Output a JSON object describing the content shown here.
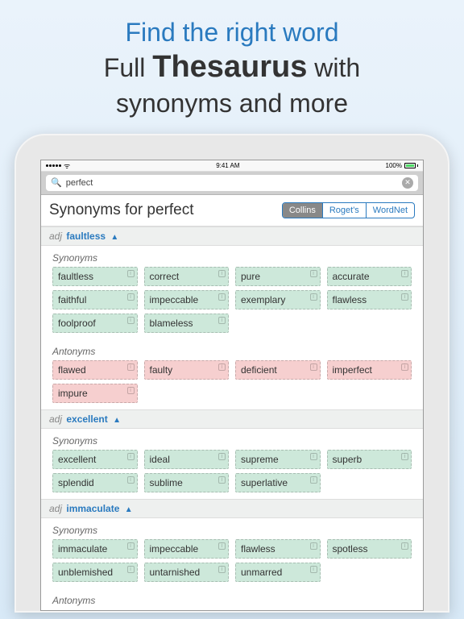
{
  "promo": {
    "line1": "Find the right word",
    "line2_a": "Full ",
    "line2_b": "Thesaurus",
    "line2_c": " with",
    "line3": "synonyms and more"
  },
  "statusbar": {
    "time": "9:41 AM",
    "battery": "100%"
  },
  "search": {
    "value": "perfect"
  },
  "header": {
    "title": "Synonyms for perfect"
  },
  "sources": {
    "collins": "Collins",
    "rogets": "Roget's",
    "wordnet": "WordNet"
  },
  "labels": {
    "synonyms": "Synonyms",
    "antonyms": "Antonyms",
    "pos_adj": "adj",
    "triangle": "▲"
  },
  "senses": {
    "s1": {
      "term": "faultless",
      "syn": [
        "faultless",
        "correct",
        "pure",
        "accurate",
        "faithful",
        "impeccable",
        "exemplary",
        "flawless",
        "foolproof",
        "blameless"
      ],
      "ant": [
        "flawed",
        "faulty",
        "deficient",
        "imperfect",
        "impure"
      ]
    },
    "s2": {
      "term": "excellent",
      "syn": [
        "excellent",
        "ideal",
        "supreme",
        "superb",
        "splendid",
        "sublime",
        "superlative"
      ]
    },
    "s3": {
      "term": "immaculate",
      "syn": [
        "immaculate",
        "impeccable",
        "flawless",
        "spotless",
        "unblemished",
        "untarnished",
        "unmarred"
      ]
    }
  }
}
